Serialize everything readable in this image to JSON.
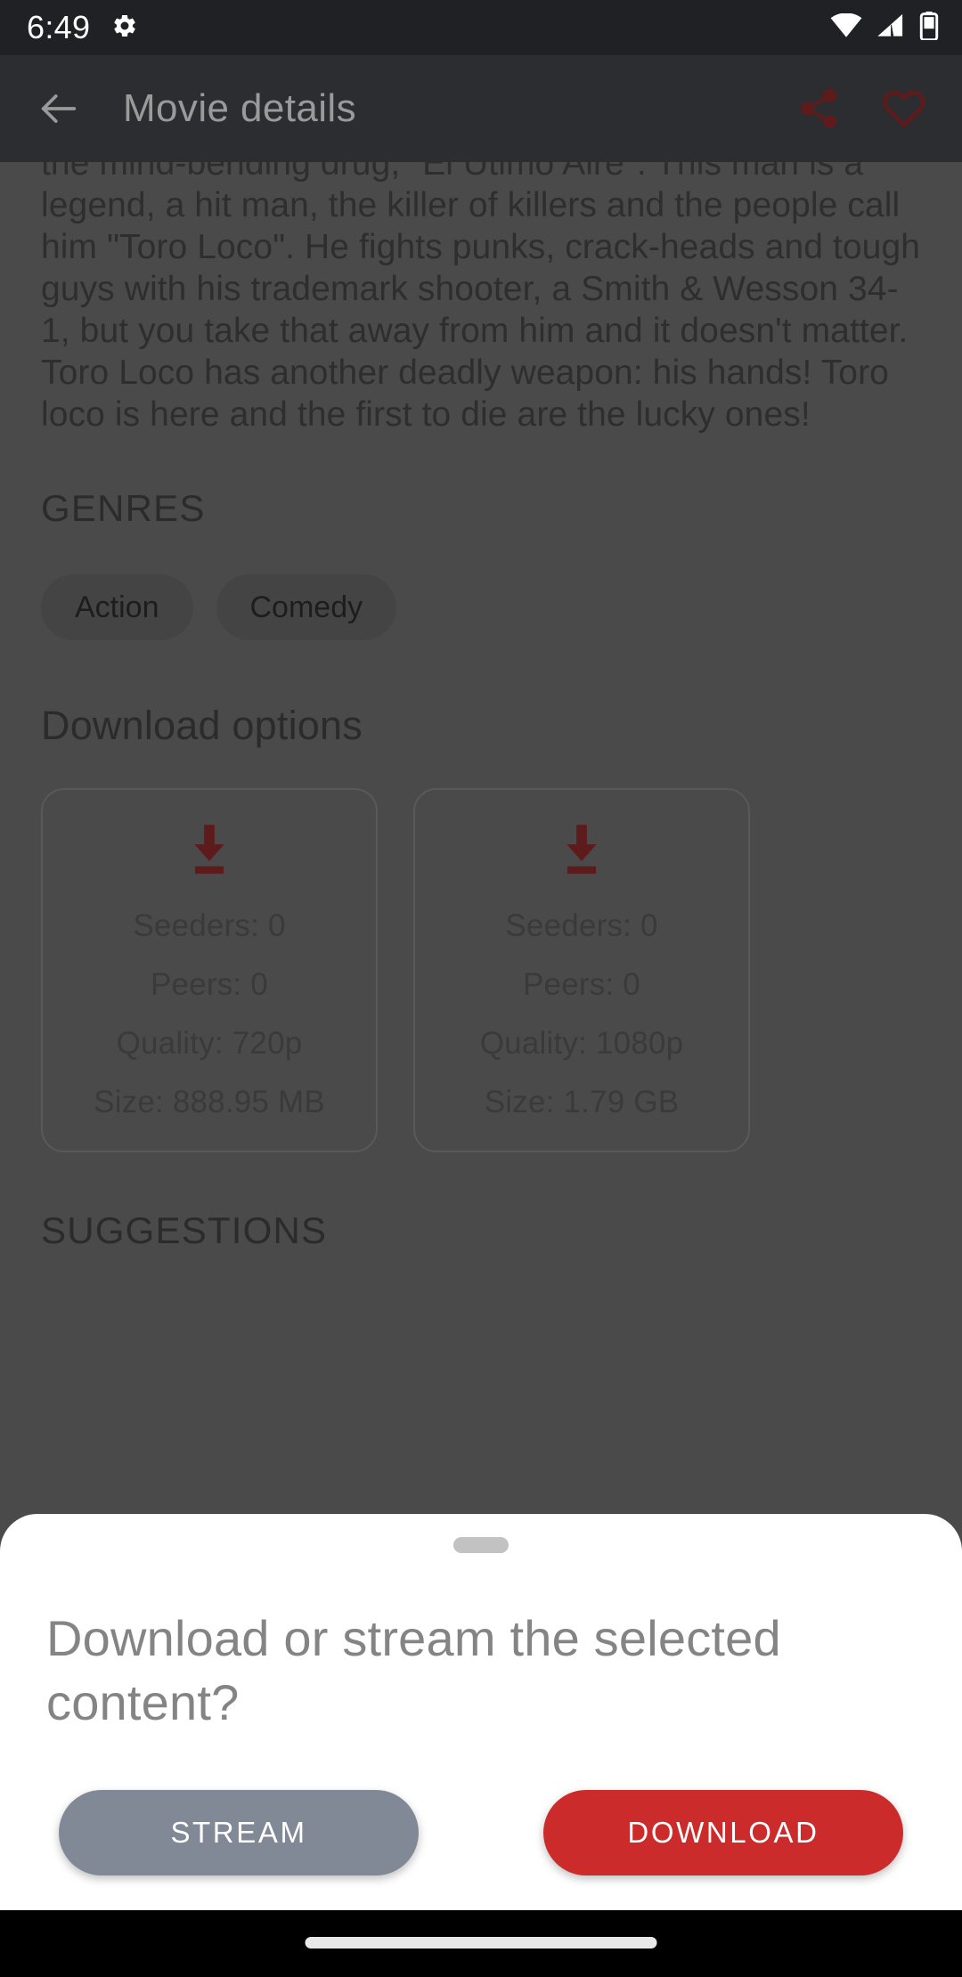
{
  "status_bar": {
    "time": "6:49",
    "icons": [
      "gear-icon",
      "wifi-icon",
      "cellular-signal-icon",
      "battery-icon"
    ],
    "background": "#202124"
  },
  "app_bar": {
    "title": "Movie details",
    "back_icon": "arrow-left-icon",
    "share_icon": "share-icon",
    "favorite_icon": "heart-outline-icon",
    "background": "#2b2d31",
    "accent": "#c62828"
  },
  "content": {
    "description": "the mind-bending drug, \"El Utimo Aire\". This man is a legend, a hit man, the killer of killers and the people call him \"Toro Loco\". He fights punks, crack-heads and tough guys with his trademark shooter, a Smith & Wesson 34-1, but you take that away from him and it doesn't matter. Toro Loco has another deadly weapon: his hands! Toro loco is here and the first to die are the lucky ones!",
    "genres_header": "GENRES",
    "genres": [
      "Action",
      "Comedy"
    ],
    "download_options_header": "Download options",
    "download_options": [
      {
        "icon": "download-arrow-icon",
        "seeders": "Seeders: 0",
        "peers": "Peers: 0",
        "quality": "Quality: 720p",
        "size": "Size: 888.95 MB"
      },
      {
        "icon": "download-arrow-icon",
        "seeders": "Seeders: 0",
        "peers": "Peers: 0",
        "quality": "Quality: 1080p",
        "size": "Size: 1.79 GB"
      }
    ],
    "suggestions_header": "SUGGESTIONS"
  },
  "bottom_sheet": {
    "handle": "drag-handle",
    "title": "Download or stream the selected content?",
    "stream_label": "STREAM",
    "download_label": "DOWNLOAD",
    "stream_color": "#828996",
    "download_color": "#cc2b2b"
  },
  "nav_bar": {
    "home_indicator": "home-indicator"
  }
}
